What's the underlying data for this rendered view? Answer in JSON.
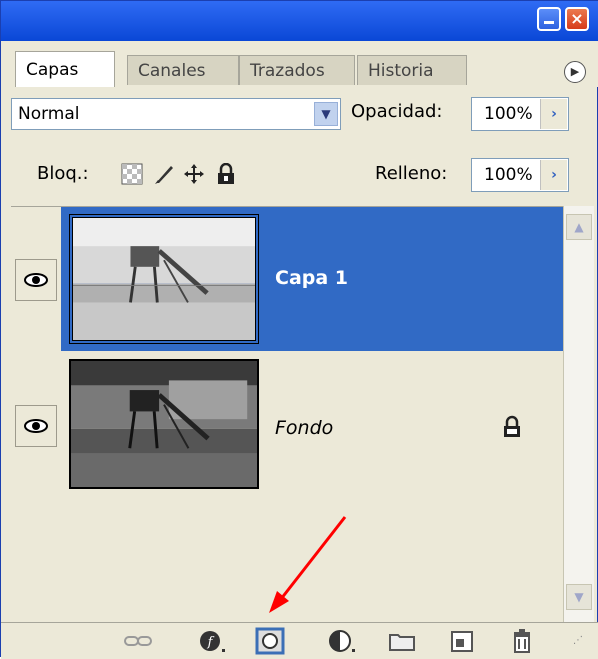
{
  "tabs": [
    {
      "label": "Capas",
      "active": true
    },
    {
      "label": "Canales",
      "active": false
    },
    {
      "label": "Trazados",
      "active": false
    },
    {
      "label": "Historia",
      "active": false
    }
  ],
  "tab_menu_icon": "flyout-menu-icon",
  "blend_mode": {
    "value": "Normal"
  },
  "opacity": {
    "label": "Opacidad:",
    "value": "100%"
  },
  "lock": {
    "label": "Bloq.:",
    "icons": [
      "lock-transparency-icon",
      "lock-image-icon",
      "lock-position-icon",
      "lock-all-icon"
    ]
  },
  "fill": {
    "label": "Relleno:",
    "value": "100%"
  },
  "layers": [
    {
      "name": "Capa 1",
      "visible": true,
      "selected": true,
      "locked": false
    },
    {
      "name": "Fondo",
      "visible": true,
      "selected": false,
      "locked": true
    }
  ],
  "toolbar_icons": [
    "link-layers-icon",
    "layer-style-icon",
    "add-mask-icon",
    "adjustment-layer-icon",
    "new-group-icon",
    "new-layer-icon",
    "trash-icon"
  ],
  "colors": {
    "selection": "#316ac5",
    "panel": "#ece9d8",
    "titlebar": "#0a47d6",
    "annotation_arrow": "#ff0000"
  }
}
